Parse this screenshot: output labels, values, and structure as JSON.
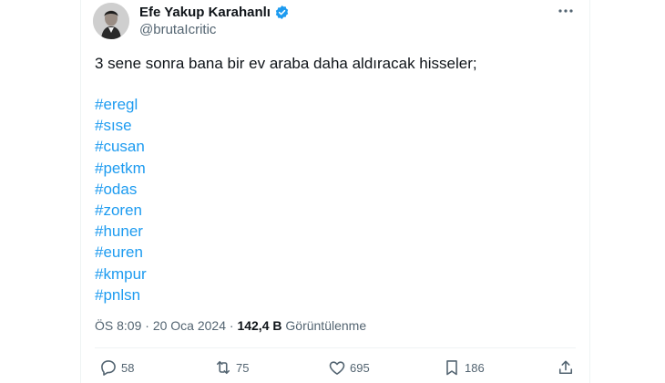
{
  "author": {
    "display_name": "Efe Yakup Karahanlı",
    "handle": "@brutaIcritic",
    "verified": true
  },
  "tweet": {
    "text": "3 sene sonra bana bir ev araba daha aldıracak hisseler;",
    "hashtags": [
      "#eregl",
      "#sıse",
      "#cusan",
      "#petkm",
      "#odas",
      "#zoren",
      "#huner",
      "#euren",
      "#kmpur",
      "#pnlsn"
    ]
  },
  "meta": {
    "time": "ÖS 8:09",
    "separator": "·",
    "date": "20 Oca 2024",
    "views_count": "142,4 B",
    "views_label": "Görüntülenme"
  },
  "actions": {
    "replies": "58",
    "retweets": "75",
    "likes": "695",
    "bookmarks": "186"
  },
  "colors": {
    "link": "#1d9bf0",
    "secondary_text": "#536471",
    "primary_text": "#0f1419",
    "divider": "#eff3f4"
  },
  "icons": [
    "verified-badge-icon",
    "more-icon",
    "reply-icon",
    "retweet-icon",
    "like-icon",
    "bookmark-icon",
    "share-icon"
  ]
}
